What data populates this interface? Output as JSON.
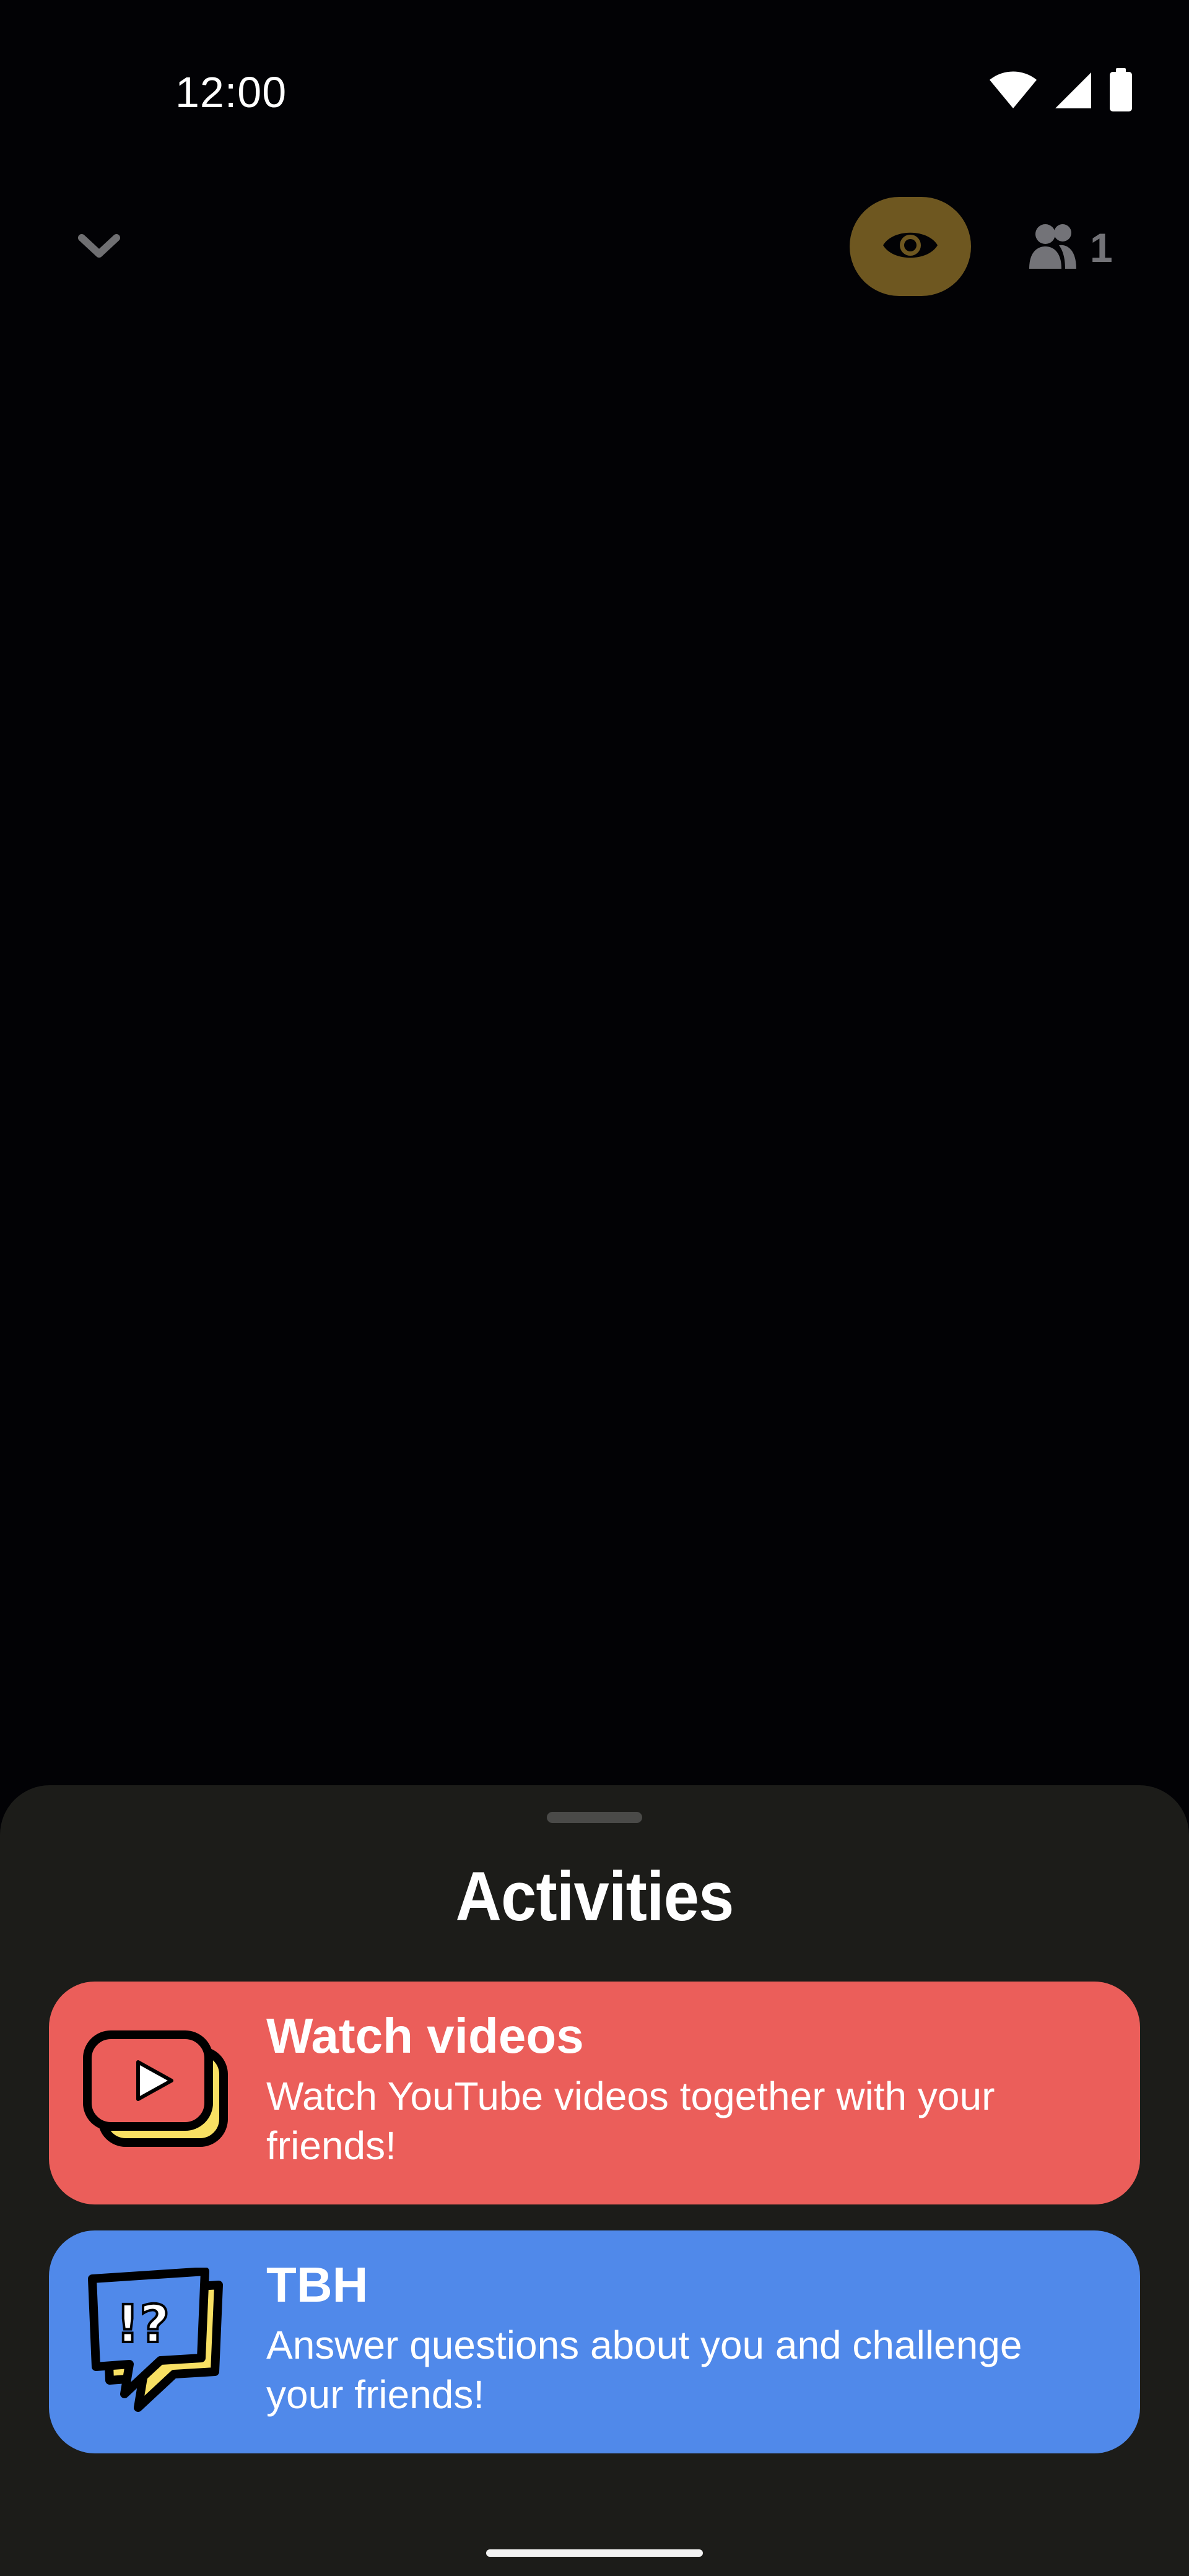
{
  "status_bar": {
    "time": "12:00",
    "icons": [
      "wifi-icon",
      "cellular-signal-icon",
      "battery-icon"
    ]
  },
  "call_controls": {
    "collapse_icon": "chevron-down-icon",
    "camera_icon": "eye-icon",
    "participants_icon": "people-icon",
    "participants_count": "1"
  },
  "sheet": {
    "title": "Activities",
    "activities": [
      {
        "title": "Watch videos",
        "description": "Watch YouTube videos together with your friends!",
        "icon": "play-video-icon",
        "color": "#eb5e5a"
      },
      {
        "title": "TBH",
        "description": "Answer questions about you and challenge your friends!",
        "icon": "question-speech-bubble-icon",
        "color": "#5089ea"
      }
    ]
  },
  "colors": {
    "background": "#020205",
    "sheet_background": "#1c1c19",
    "camera_toggle": "#6e5720",
    "icon_yellow": "#f8e063"
  }
}
